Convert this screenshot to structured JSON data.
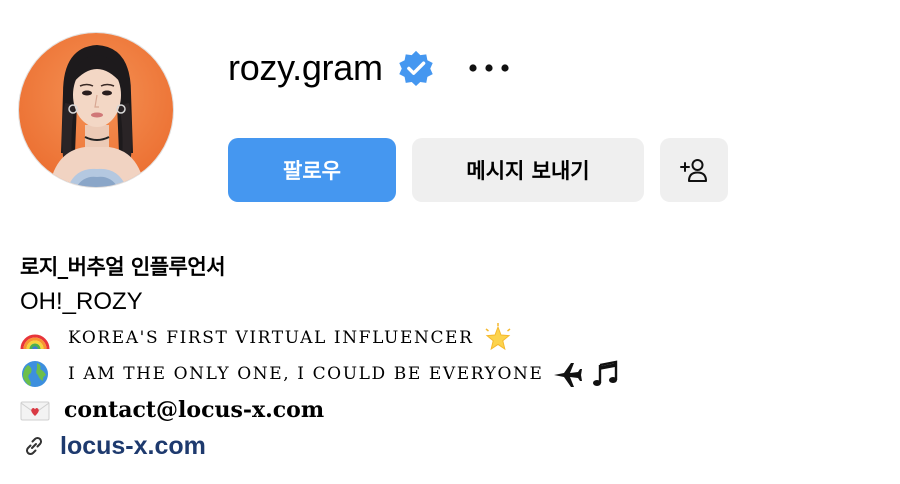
{
  "profile": {
    "username": "rozy.gram",
    "verified": true,
    "avatar_bg": "#f07a3c"
  },
  "actions": {
    "follow_label": "팔로우",
    "message_label": "메시지 보내기",
    "follow_color": "#4597f0"
  },
  "bio": {
    "name": "로지_버추얼 인플루언서",
    "handle": "OH!_ROZY",
    "line1": "KOREA'S FIRST VIRTUAL INFLUENCER",
    "line2": "I AM THE ONLY ONE, I COULD BE EVERYONE",
    "contact": "contact@locus-x.com",
    "link": "locus-x.com"
  },
  "icons": {
    "verified": "verified-badge-icon",
    "more": "more-options-icon",
    "add_person": "add-person-icon",
    "rainbow": "rainbow-icon",
    "star": "glowing-star-icon",
    "globe": "globe-icon",
    "plane": "airplane-icon",
    "music": "music-notes-icon",
    "envelope": "love-letter-icon",
    "link": "link-icon"
  }
}
